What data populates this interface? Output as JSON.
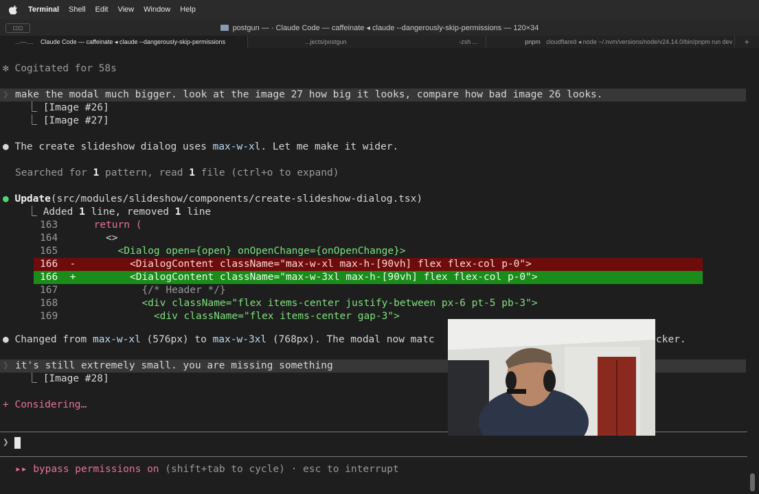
{
  "menubar": {
    "app": "Terminal",
    "items": [
      "Shell",
      "Edit",
      "View",
      "Window",
      "Help"
    ]
  },
  "window": {
    "btn": "⊡⊡",
    "title": "postgun — · Claude Code — caffeinate ◂ claude --dangerously-skip-permissions — 120×34"
  },
  "tabs": [
    {
      "label": "Claude Code — caffeinate ◂ claude --dangerously-skip-permissions",
      "prefix": "...—...."
    },
    {
      "label": "...jects/postgun",
      "suffix": "-zsh ..."
    },
    {
      "label": "pnpm",
      "detail": "cloudflared ◂ node ~/.nvm/versions/node/v24.14.0/bin/pnpm run dev ..."
    }
  ],
  "terminal": {
    "cogitated": "✻ Cogitated for 58s",
    "prompt1": "make the modal much bigger. look at the image 27 how big it looks, compare how bad image 26 looks.",
    "img26": "  ⎿ [Image #26]",
    "img27": "  ⎿ [Image #27]",
    "msg1_pre": "The create slideshow dialog uses ",
    "msg1_code": "max-w-xl",
    "msg1_post": ". Let me make it wider.",
    "searched_a": "Searched for ",
    "searched_n1": "1",
    "searched_b": " pattern, read ",
    "searched_n2": "1",
    "searched_c": " file (ctrl+o to expand)",
    "update_label": "Update",
    "update_path": "(src/modules/slideshow/components/create-slideshow-dialog.tsx)",
    "added_a": "  ⎿ Added ",
    "added_n1": "1",
    "added_b": " line, removed ",
    "added_n2": "1",
    "added_c": " line",
    "code": [
      {
        "no": "163",
        "mark": " ",
        "text": "  return ("
      },
      {
        "no": "164",
        "mark": " ",
        "text": "    <>"
      },
      {
        "no": "165",
        "mark": " ",
        "text": "      <Dialog open={open} onOpenChange={onOpenChange}>"
      },
      {
        "no": "166",
        "mark": "-",
        "text": "        <DialogContent className=\"max-w-xl max-h-[90vh] flex flex-col p-0\">"
      },
      {
        "no": "166",
        "mark": "+",
        "text": "        <DialogContent className=\"max-w-3xl max-h-[90vh] flex flex-col p-0\">"
      },
      {
        "no": "167",
        "mark": " ",
        "text": "          {/* Header */}"
      },
      {
        "no": "168",
        "mark": " ",
        "text": "          <div className=\"flex items-center justify-between px-6 pt-5 pb-3\">"
      },
      {
        "no": "169",
        "mark": " ",
        "text": "            <div className=\"flex items-center gap-3\">"
      }
    ],
    "changed_a": "Changed from ",
    "changed_c1": "max-w-xl",
    "changed_b": " (576px) to ",
    "changed_c2": "max-w-3xl",
    "changed_c": " (768px). The modal now matc",
    "changed_tail": "cker.",
    "prompt2": "it's still extremely small. you are missing something",
    "img28": "  ⎿ [Image #28]",
    "considering": "+ Considering…",
    "input_prompt": "❯",
    "bypass_arrows": "▸▸ ",
    "bypass_label": "bypass permissions on",
    "bypass_hint": " (shift+tab to cycle) · esc to interrupt"
  },
  "colors": {
    "bg": "#1e1e1e",
    "success": "#4fd66a",
    "accent": "#e8729a",
    "diff_del": "#6e0c0c",
    "diff_add": "#1a8c1a"
  }
}
